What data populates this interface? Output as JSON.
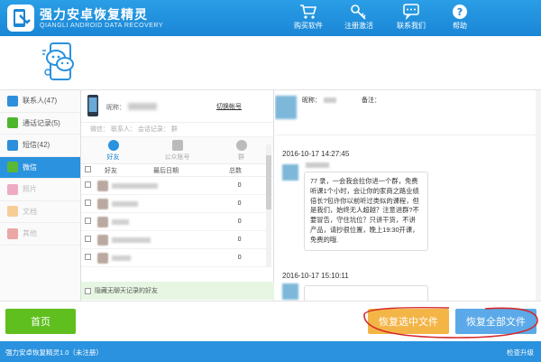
{
  "app": {
    "title": "强力安卓恢复精灵",
    "subtitle": "QIANGLI ANDROID DATA RECOVERY"
  },
  "toolbar": {
    "buy_label": "购买软件",
    "register_label": "注册激活",
    "contact_label": "联系我们",
    "help_label": "帮助"
  },
  "sidebar": {
    "items": [
      {
        "label": "联系人(47)",
        "color": "#2d8fdc"
      },
      {
        "label": "通话记录(5)",
        "color": "#4fb52f"
      },
      {
        "label": "短信(42)",
        "color": "#2d8fdc"
      },
      {
        "label": "微信",
        "color": "#5ab837"
      },
      {
        "label": "照片",
        "color": "#e05a8a"
      },
      {
        "label": "文档",
        "color": "#f0a030"
      },
      {
        "label": "其他",
        "color": "#d9544f"
      }
    ]
  },
  "contacts_panel": {
    "nickname_label": "昵称：",
    "switch_account": "切换帐号",
    "meta_text": "微信：  联系人：  会话记录：  群",
    "tabs": [
      {
        "label": "好友"
      },
      {
        "label": "公众账号"
      },
      {
        "label": "群"
      }
    ],
    "columns": {
      "friend": "好友",
      "last_date": "最后日期",
      "total": "总数"
    },
    "rows": [
      {
        "count": "0"
      },
      {
        "count": "0"
      },
      {
        "count": "0"
      },
      {
        "count": "0"
      },
      {
        "count": "0"
      }
    ],
    "hide_empty": "隐藏无聊天记录的好友"
  },
  "chat": {
    "nickname_label": "昵称：",
    "note_label": "备注：",
    "timestamp1": "2016-10-17 14:27:45",
    "message1": "77 录，一会我会拉你进一个群，免费听课1个小时，会让你的家商之路业绩倍长?包许你以前听过类似的课程，但是我们，始终无人超越？注意进群?不要冒告，守住坑位？只讲干货，不讲产品，请抄很位置，晚上19:30开课，免费的哦.",
    "timestamp2": "2016-10-17 15:10:11"
  },
  "bottom": {
    "home_label": "首页",
    "recover_selected": "恢复选中文件",
    "recover_all": "恢复全部文件"
  },
  "status": {
    "version": "强力安卓恢复精灵1.0（未注册）",
    "upgrade": "检查升级"
  },
  "colors": {
    "primary": "#1a86d6",
    "green": "#5fbf1f",
    "orange": "#f4b547",
    "light_blue": "#5ba9e8",
    "annotation_red": "#d42a2a"
  }
}
